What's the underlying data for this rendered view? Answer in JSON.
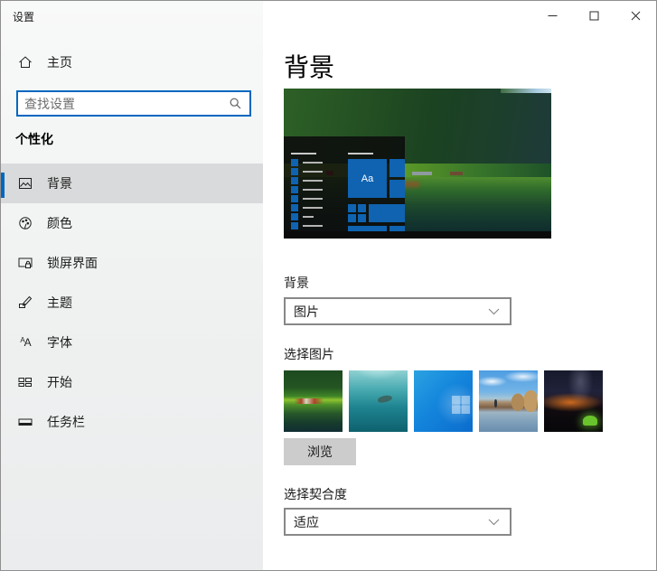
{
  "window": {
    "title": "设置"
  },
  "titlebar": {
    "minimize_tooltip": "最小化",
    "maximize_tooltip": "最大化",
    "close_tooltip": "关闭"
  },
  "sidebar": {
    "home_label": "主页",
    "search_placeholder": "查找设置",
    "section_header": "个性化",
    "items": [
      {
        "label": "背景",
        "selected": true
      },
      {
        "label": "颜色",
        "selected": false
      },
      {
        "label": "锁屏界面",
        "selected": false
      },
      {
        "label": "主题",
        "selected": false
      },
      {
        "label": "字体",
        "selected": false
      },
      {
        "label": "开始",
        "selected": false
      },
      {
        "label": "任务栏",
        "selected": false
      }
    ],
    "fonts_icon_small": "A",
    "fonts_icon_large": "A"
  },
  "main": {
    "page_title": "背景",
    "preview": {
      "description": "峡湾村庄壁纸预览，含开始菜单与任务栏叠层",
      "tile_label": "Aa"
    },
    "background_dropdown": {
      "label": "背景",
      "value": "图片"
    },
    "choose_picture": {
      "label": "选择图片",
      "browse_button": "浏览",
      "thumbnails": [
        {
          "name": "峡湾村庄"
        },
        {
          "name": "水下潜水员"
        },
        {
          "name": "Windows 默认蓝色"
        },
        {
          "name": "海滩岩拱"
        },
        {
          "name": "夜晚帐篷"
        }
      ]
    },
    "fit_dropdown": {
      "label": "选择契合度",
      "value": "适应"
    }
  },
  "colors": {
    "accent": "#0067c0",
    "tile_blue": "#0f63b1",
    "selected_item_bg": "#d9dadb",
    "menu_overlay": "rgba(13,13,13,0.88)"
  }
}
